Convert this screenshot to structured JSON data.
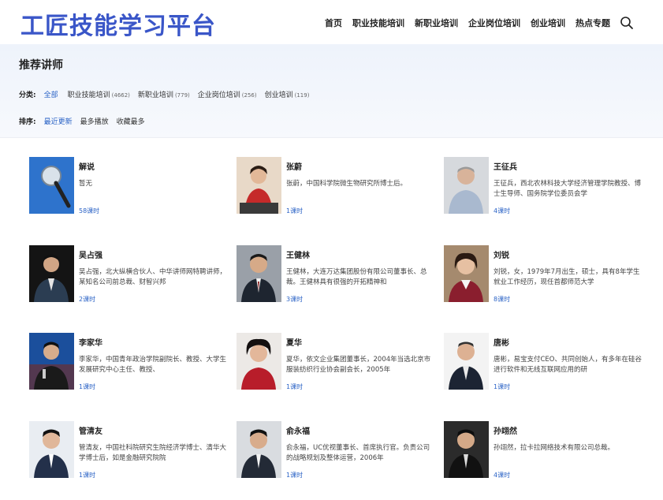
{
  "site": {
    "logo_text": "工匠技能学习平台"
  },
  "nav": {
    "items": [
      "首页",
      "职业技能培训",
      "新职业培训",
      "企业岗位培训",
      "创业培训",
      "热点专题"
    ]
  },
  "filter": {
    "title": "推荐讲师",
    "category_label": "分类:",
    "categories": [
      {
        "label": "全部",
        "count": ""
      },
      {
        "label": "职业技能培训",
        "count": "(4662)"
      },
      {
        "label": "新职业培训",
        "count": "(779)"
      },
      {
        "label": "企业岗位培训",
        "count": "(256)"
      },
      {
        "label": "创业培训",
        "count": "(119)"
      }
    ],
    "sort_label": "排序:",
    "sorts": [
      "最近更新",
      "最多播放",
      "收藏最多"
    ]
  },
  "teachers": [
    {
      "name": "解说",
      "desc": "暂无",
      "lessons": "58课时"
    },
    {
      "name": "张蔚",
      "desc": "张蔚，中国科学院微生物研究所博士后。",
      "lessons": "1课时"
    },
    {
      "name": "王征兵",
      "desc": "王征兵，西北农林科技大学经济管理学院教授、博士生导师、国务院学位委员会学",
      "lessons": "4课时"
    },
    {
      "name": "吴占强",
      "desc": "吴占强，北大纵横合伙人、中华讲师网特聘讲师，某知名公司前总裁、财智兴邦",
      "lessons": "2课时"
    },
    {
      "name": "王健林",
      "desc": "王健林，大连万达集团股份有限公司董事长、总裁。王健林具有很强的开拓精神和",
      "lessons": "3课时"
    },
    {
      "name": "刘锐",
      "desc": "刘锐，女，1979年7月出生，硕士，具有8年学生就业工作经历，现任首都师范大学",
      "lessons": "8课时"
    },
    {
      "name": "李家华",
      "desc": "李家华，中国青年政治学院副院长、教授、大学生发展研究中心主任、教授、",
      "lessons": "1课时"
    },
    {
      "name": "夏华",
      "desc": "夏华，依文企业集团董事长，2004年当选北京市服装纺织行业协会副会长，2005年",
      "lessons": "1课时"
    },
    {
      "name": "唐彬",
      "desc": "唐彬，易宝支付CEO、共同创始人，有多年在硅谷进行软件和无线互联网应用的研",
      "lessons": "1课时"
    },
    {
      "name": "管清友",
      "desc": "管清友，中国社科院研究生院经济学博士、清华大学博士后，如是金融研究院院",
      "lessons": "1课时"
    },
    {
      "name": "俞永福",
      "desc": "俞永福，UC优视董事长、首席执行官。负责公司的战略规划及整体运营，2006年",
      "lessons": "1课时"
    },
    {
      "name": "孙翊然",
      "desc": "孙翊然，拉卡拉网络技术有限公司总裁。",
      "lessons": "4课时"
    }
  ]
}
